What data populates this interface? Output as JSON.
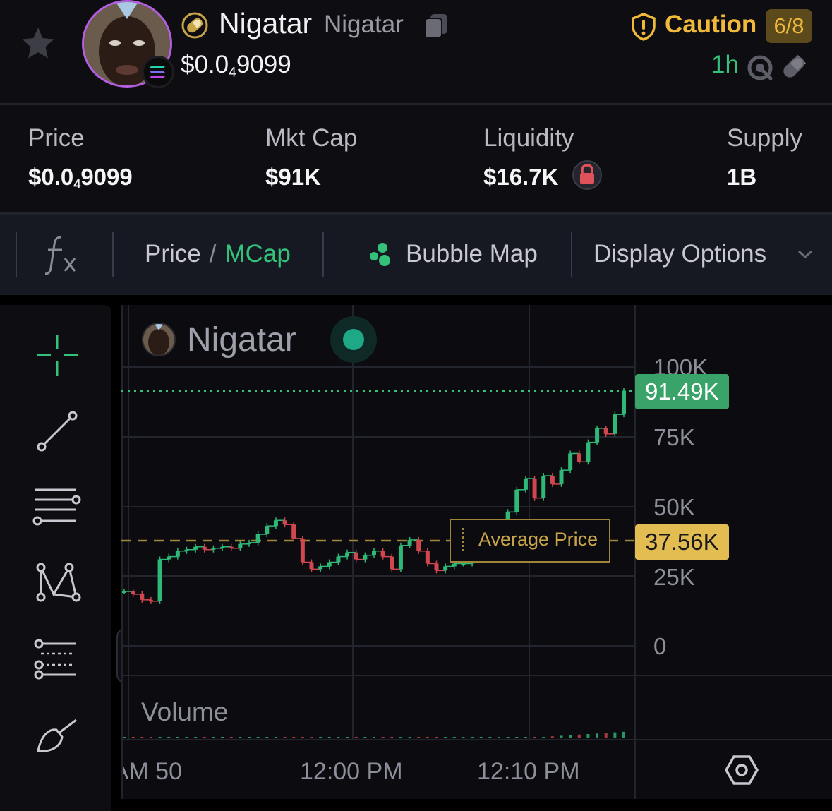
{
  "header": {
    "token_name": "Nigatar",
    "token_symbol": "Nigatar",
    "price_prefix": "$0.0",
    "price_zero_count": "4",
    "price_digits": "9099",
    "caution_label": "Caution",
    "risk_score": "6/8",
    "age": "1h"
  },
  "stats": {
    "price_label": "Price",
    "price_prefix": "$0.0",
    "price_zero_count": "4",
    "price_digits": "9099",
    "mcap_label": "Mkt Cap",
    "mcap_value": "$91K",
    "liquidity_label": "Liquidity",
    "liquidity_value": "$16.7K",
    "supply_label": "Supply",
    "supply_value": "1B"
  },
  "toolbar": {
    "price_label": "Price",
    "separator": "/",
    "mcap_label": "MCap",
    "bubble_map_label": "Bubble Map",
    "display_options_label": "Display Options"
  },
  "chart": {
    "legend_name": "Nigatar",
    "y_ticks": [
      "100K",
      "75K",
      "50K",
      "25K",
      "0"
    ],
    "current_tag": "91.49K",
    "average_tag": "37.56K",
    "average_label": "Average Price",
    "volume_label": "Volume",
    "x_ticks": [
      "50 AM",
      "12:00 PM",
      "12:10 PM"
    ]
  },
  "colors": {
    "accent_green": "#34c27a",
    "caution_gold": "#f0b93a",
    "candle_up": "#2fb877",
    "candle_down": "#d0474f",
    "average_line": "#a08536"
  },
  "chart_data": {
    "type": "line",
    "ylim": [
      0,
      100000
    ],
    "yticks": [
      "100K",
      "75K",
      "50K",
      "25K",
      "0"
    ],
    "xticks": [
      "50 AM",
      "12:00 PM",
      "12:10 PM"
    ],
    "current_value": 91490,
    "average_value": 37560,
    "series": [
      {
        "values": [
          19500,
          18500,
          16500,
          16000,
          31000,
          32000,
          34000,
          34500,
          35500,
          34500,
          35000,
          35500,
          35000,
          36500,
          37000,
          40000,
          43000,
          45000,
          43500,
          38500,
          30000,
          27500,
          28500,
          30000,
          32000,
          33500,
          31000,
          32500,
          34000,
          32000,
          27500,
          36000,
          38000,
          34000,
          29500,
          27000,
          28500,
          29500,
          29500,
          34000,
          36500,
          37000,
          42000,
          48000,
          56000,
          60000,
          53000,
          61000,
          58000,
          63000,
          69000,
          66000,
          73000,
          78000,
          76000,
          83000,
          91490
        ]
      }
    ]
  }
}
